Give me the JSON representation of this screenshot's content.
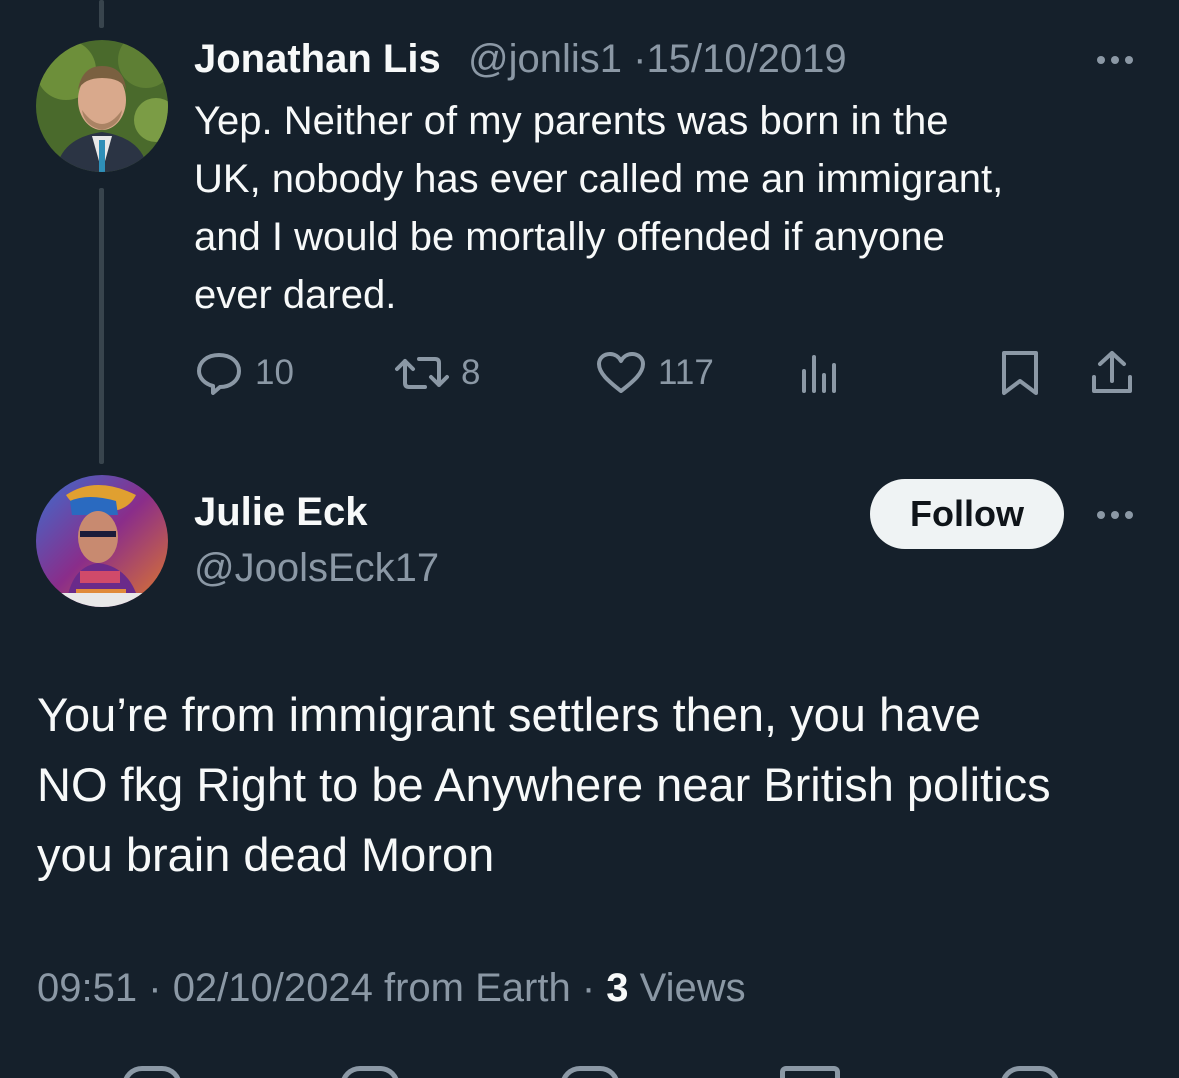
{
  "parent_tweet": {
    "display_name": "Jonathan Lis",
    "handle": "@jonlis1",
    "separator": "·",
    "date": "15/10/2019",
    "text_lines": [
      "Yep. Neither of my parents was born in the",
      "UK, nobody has ever called me an immigrant,",
      "and I would be mortally offended if anyone",
      "ever dared."
    ],
    "actions": {
      "replies": "10",
      "reposts": "8",
      "likes": "117"
    }
  },
  "main_tweet": {
    "display_name": "Julie Eck",
    "handle": "@JoolsEck17",
    "follow_label": "Follow",
    "text_lines": [
      "You’re from immigrant settlers then, you have",
      "NO fkg Right to be Anywhere near British politics",
      "you brain dead Moron"
    ],
    "time": "09:51",
    "separator": "·",
    "date": "02/10/2024 from Earth",
    "views_count": "3",
    "views_label": "Views"
  },
  "icons": {
    "reply": "reply-icon",
    "repost": "repost-icon",
    "like": "heart-icon",
    "views": "analytics-icon",
    "bookmark": "bookmark-icon",
    "share": "share-icon",
    "more": "more-icon"
  },
  "colors": {
    "background": "#15202b",
    "text_primary": "#f7f9f9",
    "text_secondary": "#8b98a5",
    "thread_line": "#38444d",
    "follow_bg": "#eff3f4"
  }
}
